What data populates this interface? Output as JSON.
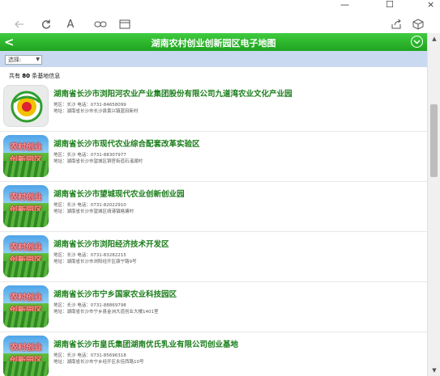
{
  "window": {
    "close_glyph": "×",
    "minimize_glyph": "—",
    "restore_glyph": "☐"
  },
  "toolbar": {
    "icons": [
      "back-arrow-icon",
      "refresh-icon",
      "reader-font-icon",
      "link-icon",
      "reading-view-icon",
      "share-icon",
      "extension-box-icon"
    ]
  },
  "header": {
    "back_glyph": "<",
    "title": "湖南农村创业创新园区电子地图"
  },
  "filter": {
    "select_value": "选择:"
  },
  "count": {
    "prefix": "共有",
    "number": "80",
    "suffix": "条基地信息"
  },
  "thumb_sign": {
    "line1": "农村创业",
    "line2": "创新园区"
  },
  "items": [
    {
      "name": "湖南省长沙市浏阳河农业产业集团股份有限公司九道湾农业文化产业园",
      "meta1": "地区：长沙  电话：0731-84658099",
      "meta2": "地址：湖南省长沙市长沙县黄兴镇蓝田新村",
      "thumb": "logo"
    },
    {
      "name": "湖南省长沙市现代农业综合配套改革实验区",
      "meta1": "地区：长沙  电话：0731-88307977",
      "meta2": "地址：湖南省长沙市望城区铜官街道石渚湖村",
      "thumb": "farm"
    },
    {
      "name": "湖南省长沙市望城现代农业创新创业园",
      "meta1": "地区：长沙  电话：0731-82022910",
      "meta2": "地址：湖南省长沙市望城区靖港镇格塘村",
      "thumb": "farm"
    },
    {
      "name": "湖南省长沙市浏阳经济技术开发区",
      "meta1": "地区：长沙  电话：0731-83282215",
      "meta2": "地址：湖南省长沙市浏阳经开区康宁路9号",
      "thumb": "farm"
    },
    {
      "name": "湖南省长沙市宁乡国家农业科技园区",
      "meta1": "地区：长沙  电话：0731-88869798",
      "meta2": "地址：湖南省长沙市宁乡县金洲大道创业大楼1401室",
      "thumb": "farm"
    },
    {
      "name": "湖南省长沙市皇氏集团湖南优氏乳业有限公司创业基地",
      "meta1": "地区：长沙  电话：0731-85696318",
      "meta2": "地址：湖南省长沙市宁乡经开区永佳西路10号",
      "thumb": "farm"
    }
  ],
  "colors": {
    "header_green": "#2eb82e",
    "title_green": "#1a7e1a",
    "filter_blue": "#c9d9ef"
  }
}
